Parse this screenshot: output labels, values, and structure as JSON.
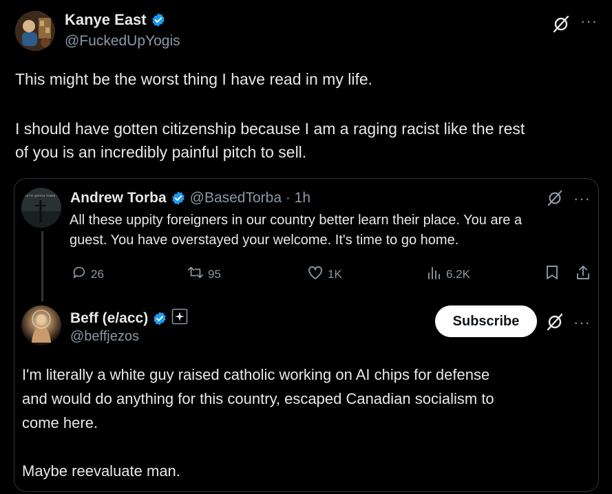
{
  "main_tweet": {
    "author_name": "Kanye East",
    "handle": "@FuckedUpYogis",
    "text_lines": [
      "This might be the worst thing I have read in my life.",
      "I should have gotten citizenship because I am a raging racist like the rest",
      "of you is an incredibly painful pitch to sell."
    ]
  },
  "quoted_tweet": {
    "author_name": "Andrew Torba",
    "handle_time": "@BasedTorba · 1h",
    "text_lines": [
      "All these uppity foreigners in our country better learn their place. You are a",
      "guest. You have overstayed your welcome. It's time to go home."
    ],
    "avatar_caption": "we're gonna make it",
    "stats": {
      "replies": "26",
      "reposts": "95",
      "likes": "1K",
      "views": "6.2K"
    }
  },
  "reply_tweet": {
    "author_name": "Beff (e/acc)",
    "handle": "@beffjezos",
    "subscribe_label": "Subscribe",
    "text_lines": [
      "I'm literally a white guy raised catholic working on AI chips for defense",
      "and would do anything for this country, escaped Canadian socialism to",
      "come here.",
      "Maybe reevaluate man."
    ]
  },
  "icons": {
    "verified": "verified-badge-icon",
    "grok": "grok-icon",
    "more": "more-options-icon",
    "reply": "reply-icon",
    "repost": "repost-icon",
    "like": "like-icon",
    "views": "views-icon",
    "bookmark": "bookmark-icon",
    "share": "share-icon",
    "affiliate": "affiliate-badge-icon"
  },
  "colors": {
    "background": "#000000",
    "text": "#e7e9ea",
    "muted": "#8b98a5",
    "verified": "#1d9bf0",
    "border": "#2f3336"
  }
}
